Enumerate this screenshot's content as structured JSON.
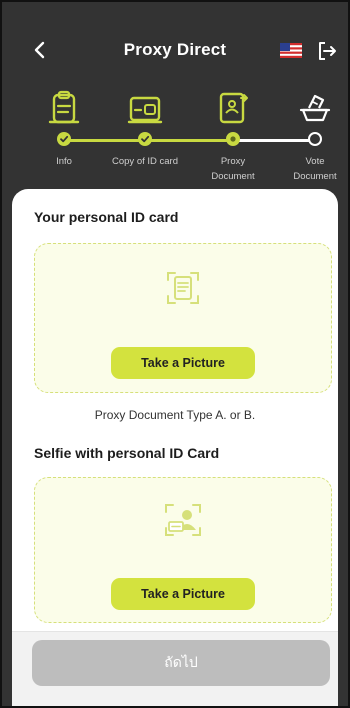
{
  "header": {
    "title": "Proxy Direct",
    "back_icon": "chevron-left-icon",
    "flag_icon": "us-flag-icon",
    "logout_icon": "logout-icon"
  },
  "stepper": {
    "steps": [
      {
        "label": "Info",
        "status": "done",
        "icon": "clipboard-icon"
      },
      {
        "label": "Copy of ID card",
        "status": "done",
        "icon": "id-card-icon"
      },
      {
        "label": "Proxy\nDocument",
        "status": "current",
        "icon": "proxy-document-icon"
      },
      {
        "label": "Vote\nDocument",
        "status": "todo",
        "icon": "ballot-box-icon"
      }
    ],
    "accent_color": "#c8d941"
  },
  "id_card_section": {
    "title": "Your personal ID card",
    "button_label": "Take a Picture",
    "icon": "document-scan-icon"
  },
  "note": "Proxy Document Type A. or B.",
  "selfie_section": {
    "title": "Selfie with personal ID Card",
    "button_label": "Take a Picture",
    "icon": "selfie-id-card-icon"
  },
  "footer": {
    "next_label": "ถัดไป"
  }
}
